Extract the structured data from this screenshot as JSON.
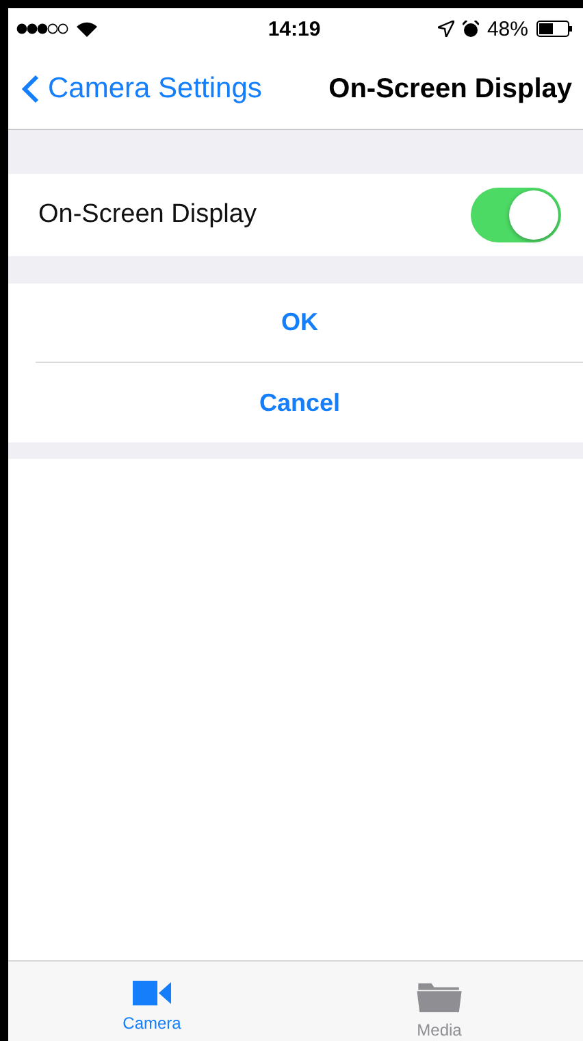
{
  "status_bar": {
    "time": "14:19",
    "battery": "48%"
  },
  "nav": {
    "back": "Camera Settings",
    "title": "On-Screen Display"
  },
  "settings": [
    {
      "label": "On-Screen Display",
      "on": true
    }
  ],
  "actions": [
    "OK",
    "Cancel"
  ],
  "tab_bar": [
    {
      "label": "Camera",
      "kind": "camera",
      "selected": true
    },
    {
      "label": "Media",
      "kind": "folder",
      "selected": false
    }
  ]
}
